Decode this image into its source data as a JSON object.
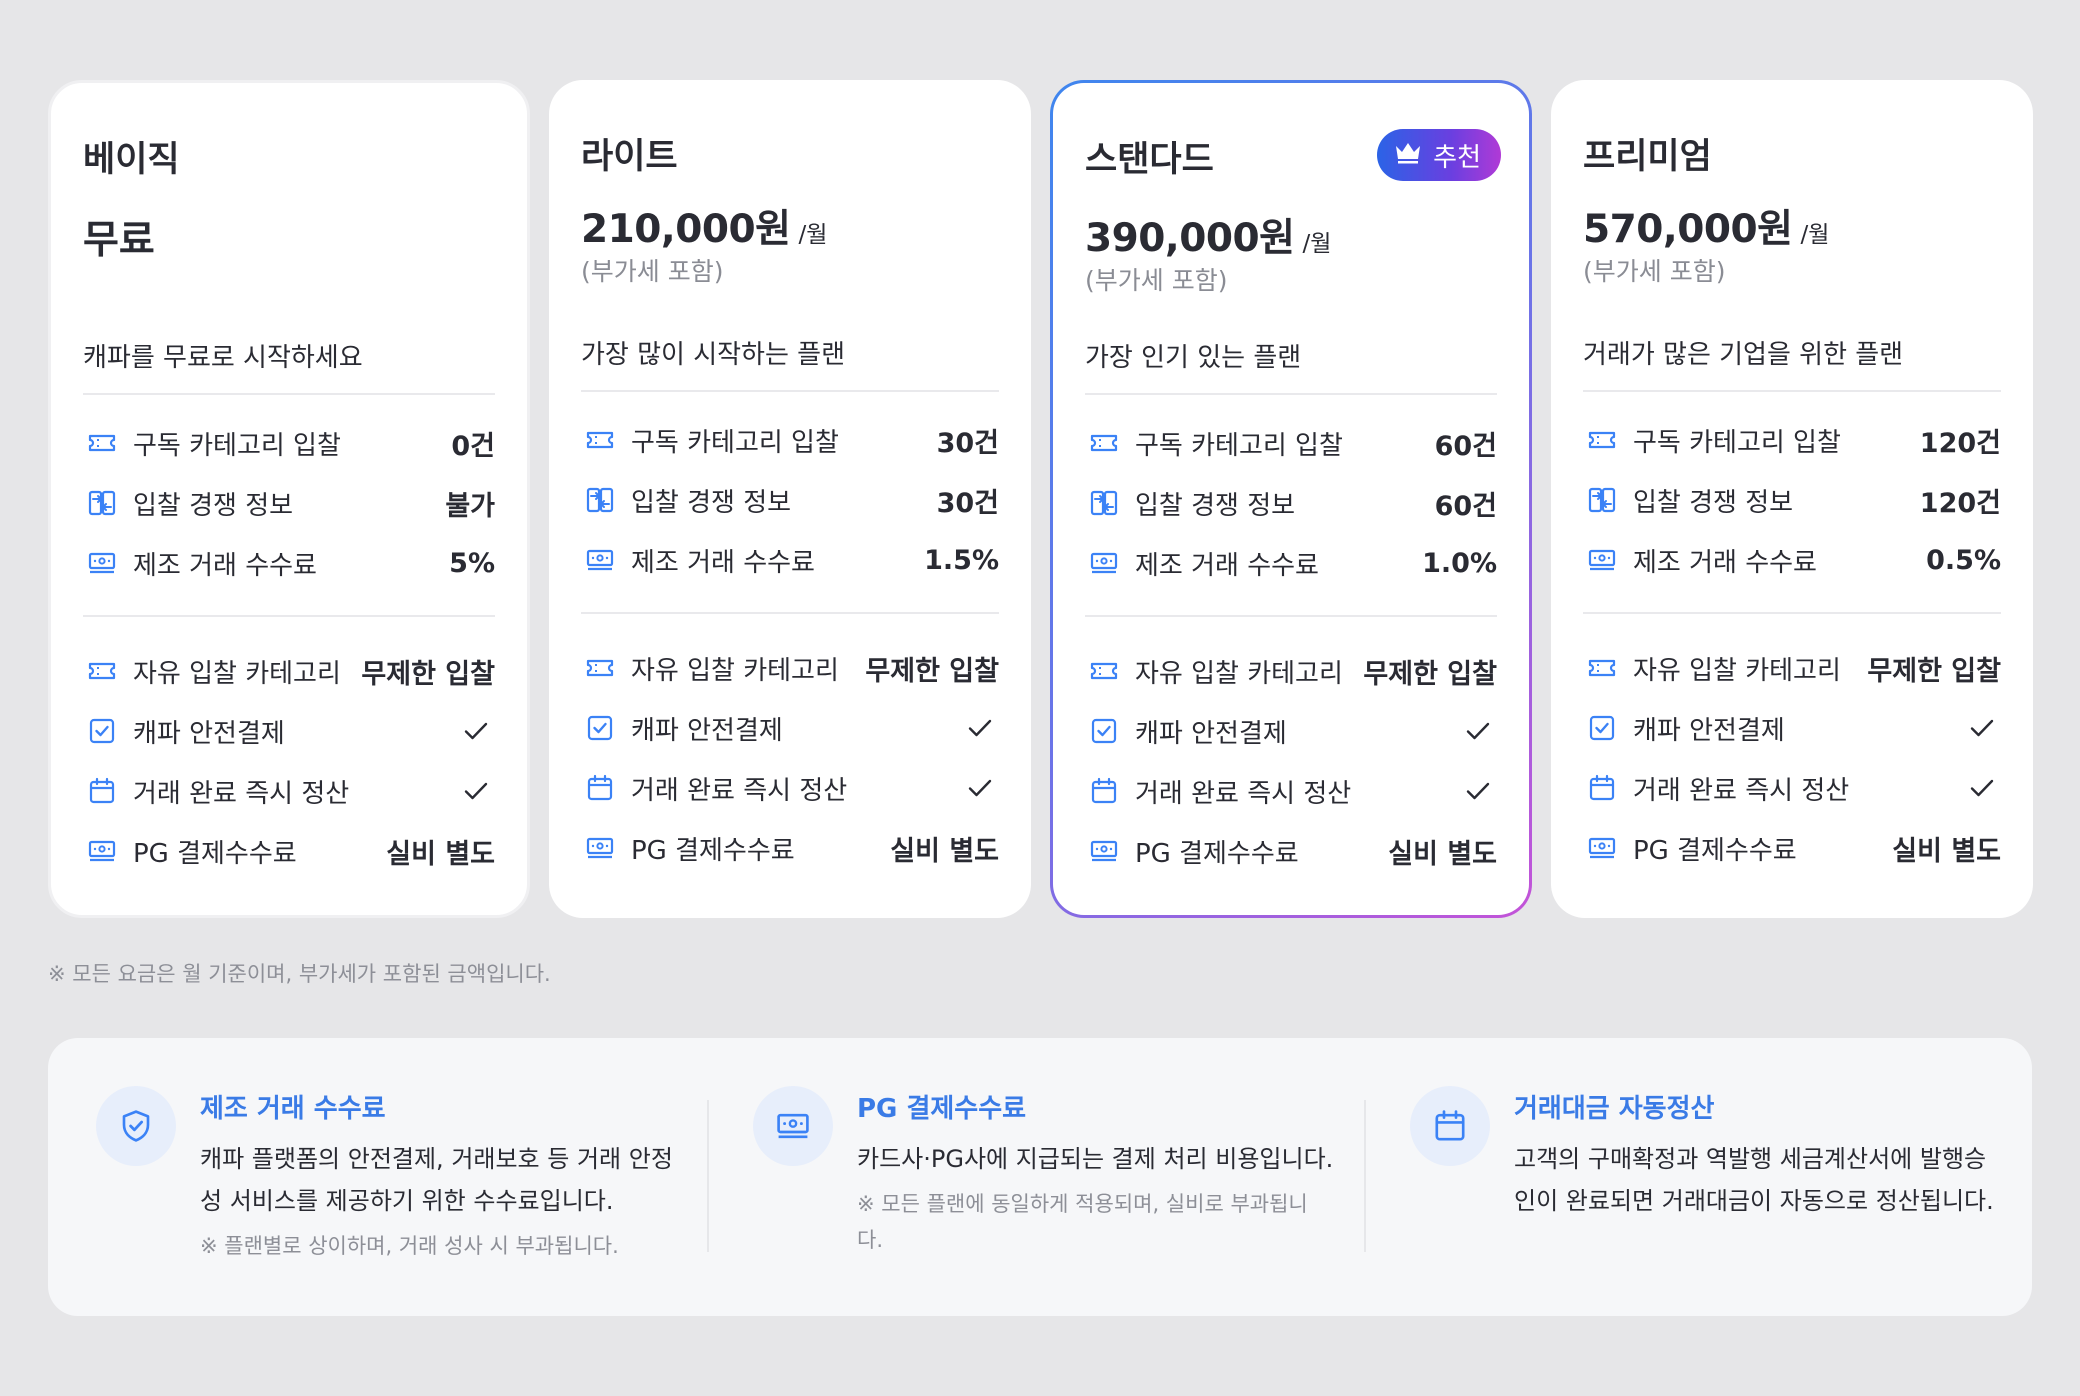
{
  "plans": [
    {
      "name": "베이직",
      "price": "무료",
      "per": "",
      "vat": "",
      "description": "캐파를 무료로 시작하세요",
      "features": [
        {
          "label": "구독 카테고리 입찰",
          "value": "0건",
          "icon": "ticket-icon"
        },
        {
          "label": "입찰 경쟁 정보",
          "value": "불가",
          "icon": "compare-icon"
        },
        {
          "label": "제조 거래 수수료",
          "value": "5%",
          "icon": "money-icon"
        },
        {
          "label": "자유 입찰 카테고리",
          "value": "무제한 입찰",
          "icon": "ticket-icon"
        },
        {
          "label": "캐파 안전결제",
          "value": "",
          "icon": "checkbox-icon"
        },
        {
          "label": "거래 완료 즉시 정산",
          "value": "",
          "icon": "calendar-icon"
        },
        {
          "label": "PG 결제수수료",
          "value": "실비 별도",
          "icon": "money-icon"
        }
      ]
    },
    {
      "name": "라이트",
      "price": "210,000원",
      "per": "/월",
      "vat": "(부가세 포함)",
      "description": "가장 많이 시작하는 플랜",
      "features": [
        {
          "label": "구독 카테고리 입찰",
          "value": "30건",
          "icon": "ticket-icon"
        },
        {
          "label": "입찰 경쟁 정보",
          "value": "30건",
          "icon": "compare-icon"
        },
        {
          "label": "제조 거래 수수료",
          "value": "1.5%",
          "icon": "money-icon"
        },
        {
          "label": "자유 입찰 카테고리",
          "value": "무제한 입찰",
          "icon": "ticket-icon"
        },
        {
          "label": "캐파 안전결제",
          "value": "",
          "icon": "checkbox-icon"
        },
        {
          "label": "거래 완료 즉시 정산",
          "value": "",
          "icon": "calendar-icon"
        },
        {
          "label": "PG 결제수수료",
          "value": "실비 별도",
          "icon": "money-icon"
        }
      ]
    },
    {
      "name": "스탠다드",
      "badge": "추천",
      "price": "390,000원",
      "per": "/월",
      "vat": "(부가세 포함)",
      "description": "가장 인기 있는 플랜",
      "features": [
        {
          "label": "구독 카테고리 입찰",
          "value": "60건",
          "icon": "ticket-icon"
        },
        {
          "label": "입찰 경쟁 정보",
          "value": "60건",
          "icon": "compare-icon"
        },
        {
          "label": "제조 거래 수수료",
          "value": "1.0%",
          "icon": "money-icon"
        },
        {
          "label": "자유 입찰 카테고리",
          "value": "무제한 입찰",
          "icon": "ticket-icon"
        },
        {
          "label": "캐파 안전결제",
          "value": "",
          "icon": "checkbox-icon"
        },
        {
          "label": "거래 완료 즉시 정산",
          "value": "",
          "icon": "calendar-icon"
        },
        {
          "label": "PG 결제수수료",
          "value": "실비 별도",
          "icon": "money-icon"
        }
      ]
    },
    {
      "name": "프리미엄",
      "price": "570,000원",
      "per": "/월",
      "vat": "(부가세 포함)",
      "description": "거래가 많은 기업을 위한 플랜",
      "features": [
        {
          "label": "구독 카테고리 입찰",
          "value": "120건",
          "icon": "ticket-icon"
        },
        {
          "label": "입찰 경쟁 정보",
          "value": "120건",
          "icon": "compare-icon"
        },
        {
          "label": "제조 거래 수수료",
          "value": "0.5%",
          "icon": "money-icon"
        },
        {
          "label": "자유 입찰 카테고리",
          "value": "무제한 입찰",
          "icon": "ticket-icon"
        },
        {
          "label": "캐파 안전결제",
          "value": "",
          "icon": "checkbox-icon"
        },
        {
          "label": "거래 완료 즉시 정산",
          "value": "",
          "icon": "calendar-icon"
        },
        {
          "label": "PG 결제수수료",
          "value": "실비 별도",
          "icon": "money-icon"
        }
      ]
    }
  ],
  "note": "※ 모든 요금은 월 기준이며, 부가세가 포함된 금액입니다.",
  "info": [
    {
      "icon": "shield-check-icon",
      "title": "제조 거래 수수료",
      "body": [
        "캐파 플랫폼의 안전결제, 거래보호 등 거래 안정",
        "성 서비스를 제공하기 위한 수수료입니다."
      ],
      "sub": [
        "※ 플랜별로 상이하며, 거래 성사 시 부과됩니다."
      ]
    },
    {
      "icon": "money-icon",
      "title": "PG 결제수수료",
      "body": [
        "카드사·PG사에 지급되는 결제 처리 비용입니다."
      ],
      "sub": [
        "※ 모든 플랜에 동일하게 적용되며, 실비로 부과됩니",
        "다."
      ]
    },
    {
      "icon": "calendar-icon",
      "title": "거래대금 자동정산",
      "body": [
        "고객의 구매확정과 역발행 세금계산서에 발행승",
        "인이 완료되면 거래대금이 자동으로 정산됩니다."
      ],
      "sub": []
    }
  ],
  "colors": {
    "accent": "#3a7be6",
    "icon_blue": "#3b82f6",
    "text": "#2a2b33",
    "muted": "#8d8f97"
  }
}
